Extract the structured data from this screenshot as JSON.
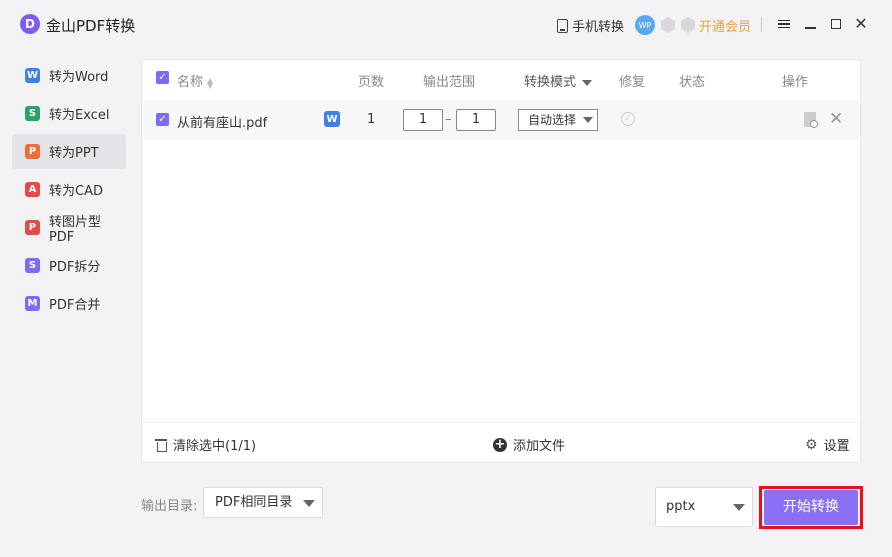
{
  "app": {
    "title": "金山PDF转换",
    "logo_letter": "D",
    "mobile_convert": "手机转换",
    "wp_badge": "WP",
    "vip_link": "开通会员"
  },
  "sidebar": {
    "items": [
      {
        "label": "转为Word",
        "icon": "W",
        "icon_color": "#3f7fe8",
        "active": false
      },
      {
        "label": "转为Excel",
        "icon": "S",
        "icon_color": "#29a36a",
        "active": false
      },
      {
        "label": "转为PPT",
        "icon": "P",
        "icon_color": "#ef6c3d",
        "active": true
      },
      {
        "label": "转为CAD",
        "icon": "A",
        "icon_color": "#e64a4a",
        "active": false
      },
      {
        "label": "转图片型PDF",
        "icon": "P",
        "icon_color": "#e64a4a",
        "active": false
      },
      {
        "label": "PDF拆分",
        "icon": "S",
        "icon_color": "#7b6cf5",
        "active": false
      },
      {
        "label": "PDF合并",
        "icon": "M",
        "icon_color": "#7b6cf5",
        "active": false
      }
    ]
  },
  "table": {
    "headers": {
      "name": "名称",
      "pages": "页数",
      "range": "输出范围",
      "mode": "转换模式",
      "repair": "修复",
      "status": "状态",
      "actions": "操作"
    },
    "rows": [
      {
        "checked": true,
        "filename": "从前有座山.pdf",
        "type_badge": "W",
        "pages": "1",
        "range_from": "1",
        "range_sep": "–",
        "range_to": "1",
        "mode": "自动选择"
      }
    ]
  },
  "panel_footer": {
    "clear_selected": "清除选中(1/1)",
    "add_file": "添加文件",
    "settings": "设置"
  },
  "bottom": {
    "output_label": "输出目录:",
    "output_dir": "PDF相同目录",
    "format": "pptx",
    "start_button": "开始转换"
  },
  "colors": {
    "accent": "#8a70f4",
    "highlight_frame": "#e8111b",
    "vip": "#e6a23c"
  }
}
